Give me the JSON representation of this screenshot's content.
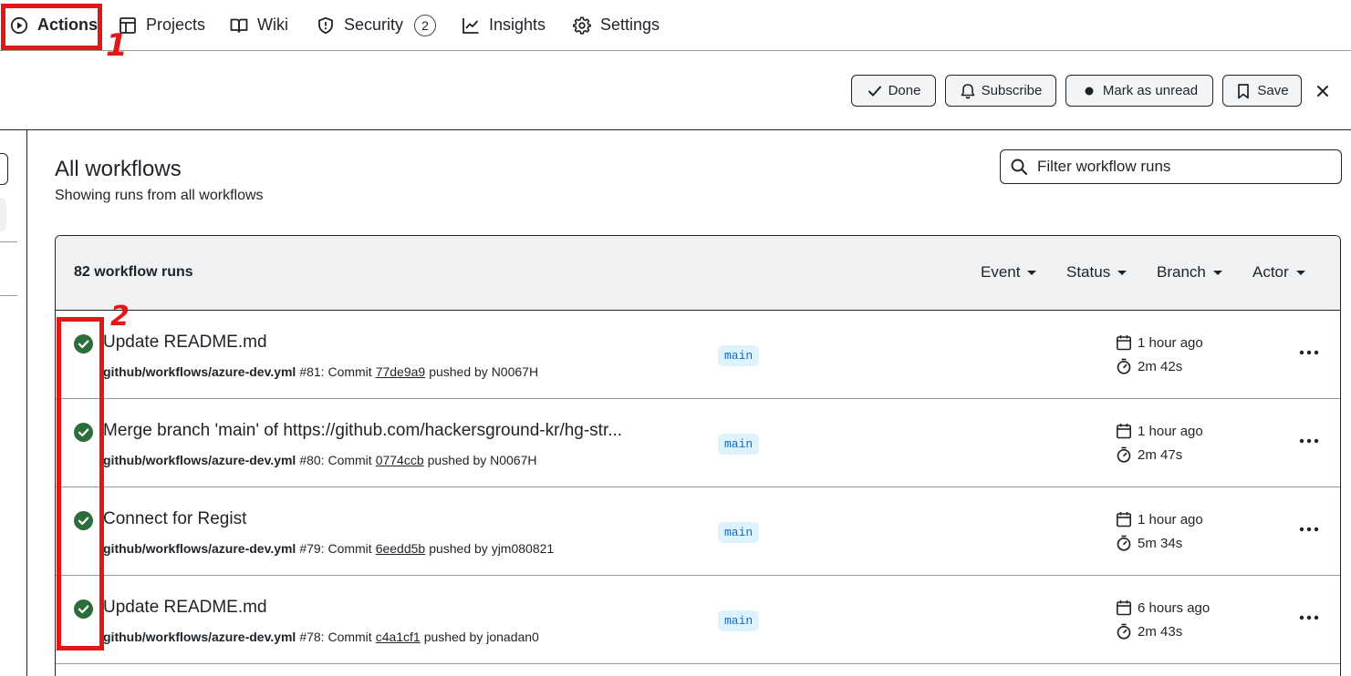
{
  "nav": {
    "items": [
      {
        "label": "Actions",
        "icon": "play-icon"
      },
      {
        "label": "Projects",
        "icon": "table-icon"
      },
      {
        "label": "Wiki",
        "icon": "book-icon"
      },
      {
        "label": "Security",
        "icon": "shield-icon",
        "count": "2"
      },
      {
        "label": "Insights",
        "icon": "graph-icon"
      },
      {
        "label": "Settings",
        "icon": "gear-icon"
      }
    ]
  },
  "annotations": {
    "one": "1",
    "two": "2",
    "color": "#e01818"
  },
  "toolbar": {
    "done": "Done",
    "subscribe": "Subscribe",
    "mark_unread": "Mark as unread",
    "save": "Save"
  },
  "page": {
    "title": "All workflows",
    "subtitle": "Showing runs from all workflows"
  },
  "filter": {
    "placeholder": "Filter workflow runs"
  },
  "runs": {
    "count_label": "82 workflow runs",
    "filters": [
      "Event",
      "Status",
      "Branch",
      "Actor"
    ],
    "items": [
      {
        "title": "Update README.md",
        "workflow": "github/workflows/azure-dev.yml",
        "run": "#81: Commit",
        "sha": "77de9a9",
        "pushed": "pushed by N0067H",
        "branch": "main",
        "ago": "1 hour ago",
        "duration": "2m 42s"
      },
      {
        "title": "Merge branch 'main' of https://github.com/hackersground-kr/hg-str...",
        "workflow": "github/workflows/azure-dev.yml",
        "run": "#80: Commit",
        "sha": "0774ccb",
        "pushed": "pushed by N0067H",
        "branch": "main",
        "ago": "1 hour ago",
        "duration": "2m 47s"
      },
      {
        "title": "Connect for Regist",
        "workflow": "github/workflows/azure-dev.yml",
        "run": "#79: Commit",
        "sha": "6eedd5b",
        "pushed": "pushed by yjm080821",
        "branch": "main",
        "ago": "1 hour ago",
        "duration": "5m 34s"
      },
      {
        "title": "Update README.md",
        "workflow": "github/workflows/azure-dev.yml",
        "run": "#78: Commit",
        "sha": "c4a1cf1",
        "pushed": "pushed by jonadan0",
        "branch": "main",
        "ago": "6 hours ago",
        "duration": "2m 43s"
      }
    ]
  },
  "colors": {
    "success": "#2c6e3a",
    "branch_bg": "#ddf4ff",
    "branch_fg": "#0969da"
  }
}
